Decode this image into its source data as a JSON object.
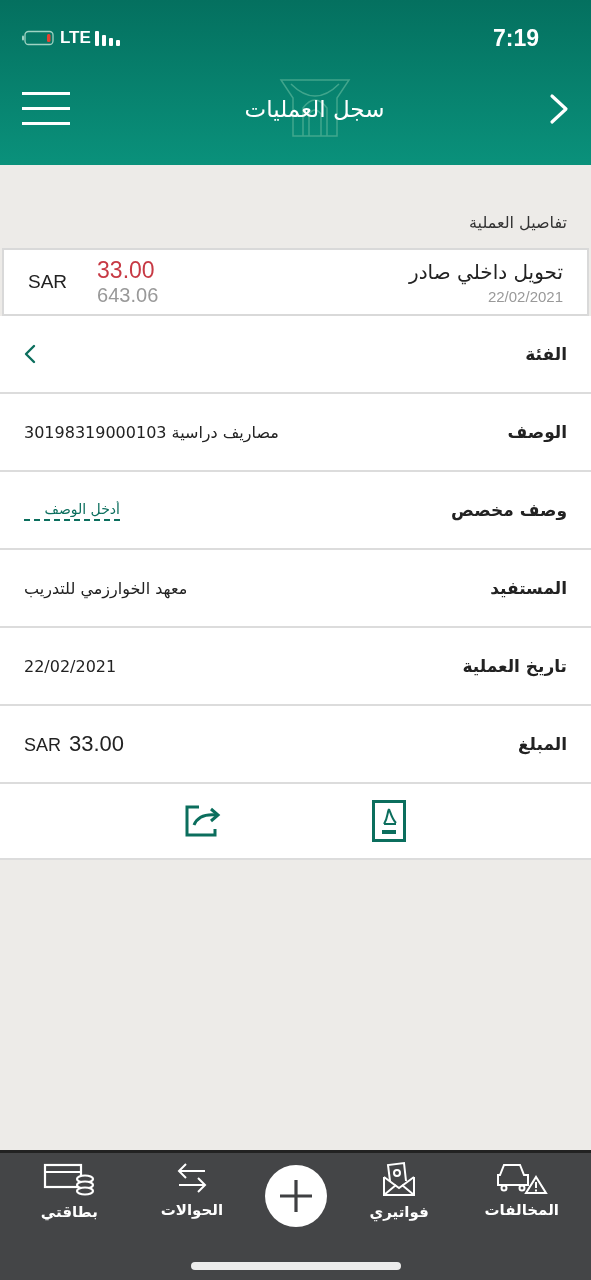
{
  "status_bar": {
    "network": "LTE",
    "time": "7:19"
  },
  "header": {
    "title": "سجل العمليات"
  },
  "section_label": "تفاصيل العملية",
  "transaction": {
    "title": "تحويل داخلي صادر",
    "date": "22/02/2021",
    "amount": "33.00",
    "balance": "643.06",
    "currency": "SAR"
  },
  "fields": [
    {
      "kind": "chevron",
      "label": "الفئة"
    },
    {
      "kind": "text",
      "label": "الوصف",
      "value": "مصاريف دراسية 30198319000103"
    },
    {
      "kind": "input",
      "label": "وصف مخصص",
      "placeholder": "أدخل الوصف"
    },
    {
      "kind": "text",
      "label": "المستفيد",
      "value": "معهد الخوارزمي للتدريب"
    },
    {
      "kind": "text",
      "label": "تاريخ العملية",
      "value": "22/02/2021"
    },
    {
      "kind": "amount",
      "label": "المبلغ",
      "currency": "SAR",
      "value": "33.00"
    }
  ],
  "tab_bar": [
    {
      "kind": "car",
      "label": "المخالفات"
    },
    {
      "kind": "bills",
      "label": "فواتيري"
    },
    {
      "kind": "plus"
    },
    {
      "kind": "transfer",
      "label": "الحوالات"
    },
    {
      "kind": "cards",
      "label": "بطاقتي"
    }
  ]
}
